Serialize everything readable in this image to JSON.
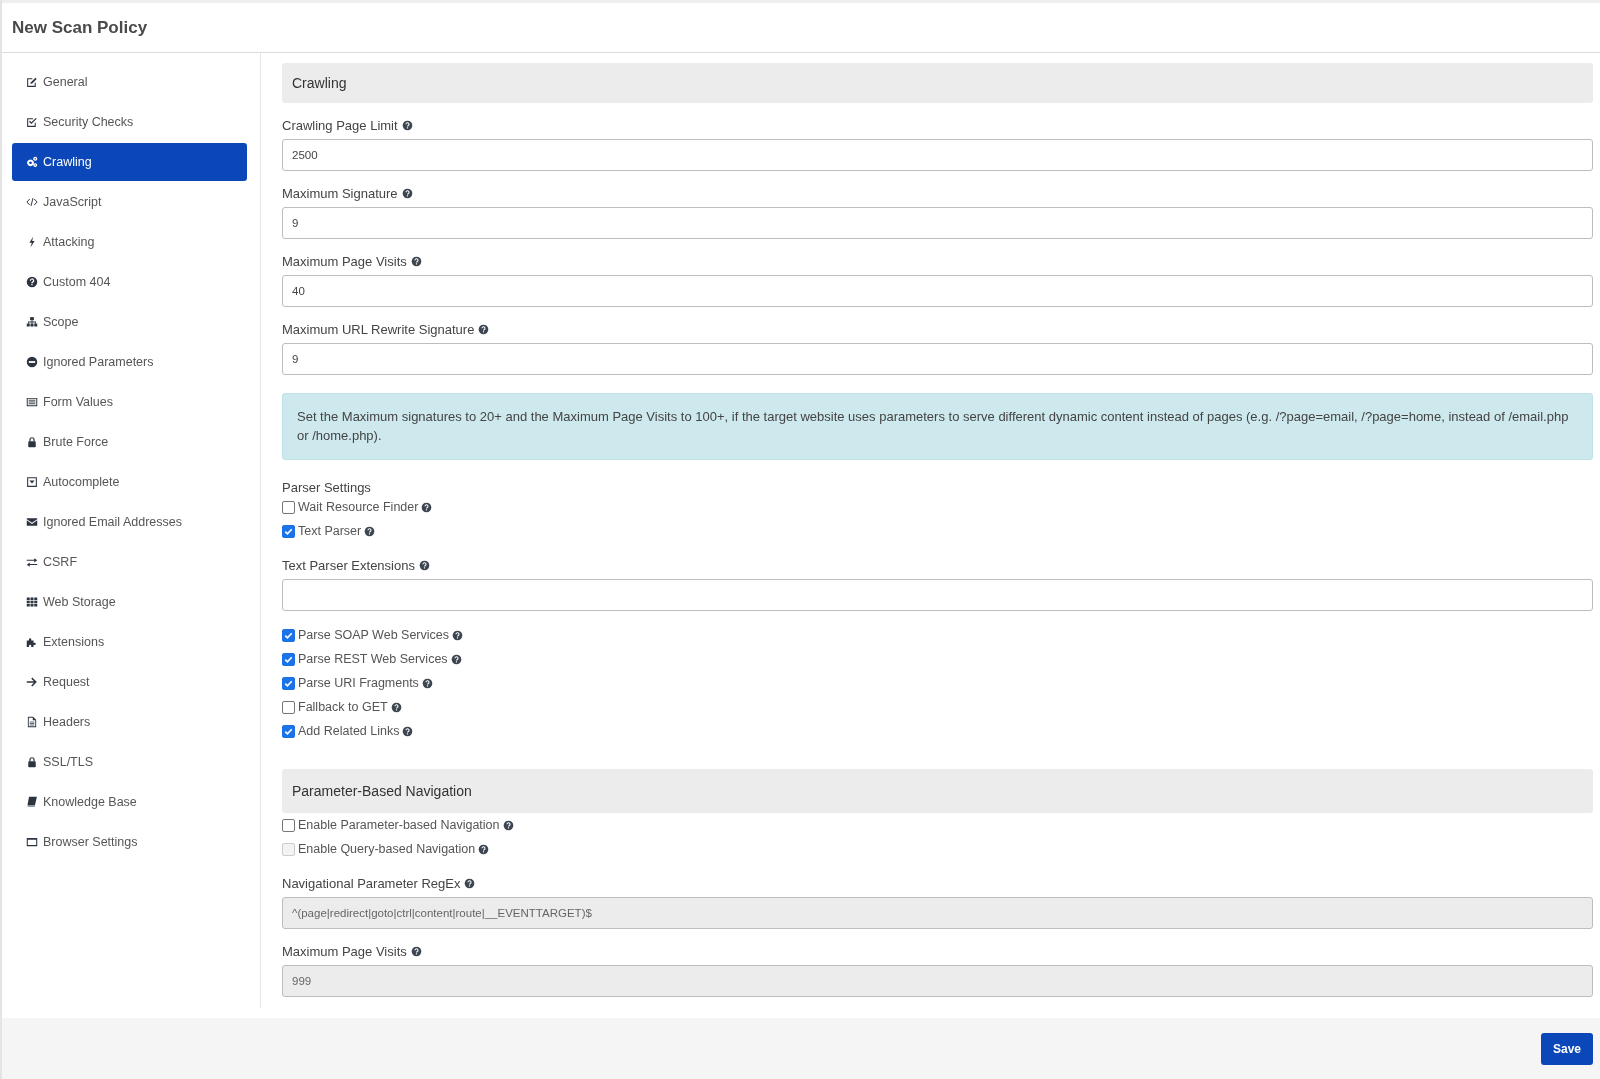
{
  "page": {
    "title": "New Scan Policy"
  },
  "sidebar": {
    "items": [
      {
        "label": "General",
        "selected": false
      },
      {
        "label": "Security Checks",
        "selected": false
      },
      {
        "label": "Crawling",
        "selected": true
      },
      {
        "label": "JavaScript",
        "selected": false
      },
      {
        "label": "Attacking",
        "selected": false
      },
      {
        "label": "Custom 404",
        "selected": false
      },
      {
        "label": "Scope",
        "selected": false
      },
      {
        "label": "Ignored Parameters",
        "selected": false
      },
      {
        "label": "Form Values",
        "selected": false
      },
      {
        "label": "Brute Force",
        "selected": false
      },
      {
        "label": "Autocomplete",
        "selected": false
      },
      {
        "label": "Ignored Email Addresses",
        "selected": false
      },
      {
        "label": "CSRF",
        "selected": false
      },
      {
        "label": "Web Storage",
        "selected": false
      },
      {
        "label": "Extensions",
        "selected": false
      },
      {
        "label": "Request",
        "selected": false
      },
      {
        "label": "Headers",
        "selected": false
      },
      {
        "label": "SSL/TLS",
        "selected": false
      },
      {
        "label": "Knowledge Base",
        "selected": false
      },
      {
        "label": "Browser Settings",
        "selected": false
      }
    ]
  },
  "main": {
    "sections": [
      {
        "title": "Crawling",
        "items": [
          {
            "kind": "field",
            "label": "Crawling Page Limit",
            "value": "2500",
            "disabled": false
          },
          {
            "kind": "field",
            "label": "Maximum Signature",
            "value": "9",
            "disabled": false
          },
          {
            "kind": "field",
            "label": "Maximum Page Visits",
            "value": "40",
            "disabled": false
          },
          {
            "kind": "field",
            "label": "Maximum URL Rewrite Signature",
            "value": "9",
            "disabled": false
          },
          {
            "kind": "note",
            "text": "Set the Maximum signatures to 20+ and the Maximum Page Visits to 100+, if the target website uses parameters to serve different dynamic content instead of pages (e.g. /?page=email, /?page=home, instead of /email.php or /home.php)."
          },
          {
            "kind": "heading",
            "label": "Parser Settings"
          },
          {
            "kind": "checkbox",
            "label": "Wait Resource Finder",
            "checked": false,
            "disabled": false
          },
          {
            "kind": "checkbox",
            "label": "Text Parser",
            "checked": true,
            "disabled": false
          },
          {
            "kind": "field",
            "label": "Text Parser Extensions",
            "disabled": false
          },
          {
            "kind": "checkbox",
            "label": "Parse SOAP Web Services",
            "checked": true,
            "disabled": false
          },
          {
            "kind": "checkbox",
            "label": "Parse REST Web Services",
            "checked": true,
            "disabled": false
          },
          {
            "kind": "checkbox",
            "label": "Parse URI Fragments",
            "checked": true,
            "disabled": false
          },
          {
            "kind": "checkbox",
            "label": "Fallback to GET",
            "checked": false,
            "disabled": false
          },
          {
            "kind": "checkbox",
            "label": "Add Related Links",
            "checked": true,
            "disabled": false
          }
        ]
      },
      {
        "title": "Parameter-Based Navigation",
        "items": [
          {
            "kind": "checkbox",
            "label": "Enable Parameter-based Navigation",
            "checked": false,
            "disabled": false
          },
          {
            "kind": "checkbox",
            "label": "Enable Query-based Navigation",
            "checked": false,
            "disabled": true
          },
          {
            "kind": "field",
            "label": "Navigational Parameter RegEx",
            "value": "^(page|redirect|goto|ctrl|content|route|__EVENTTARGET)$",
            "disabled": true
          },
          {
            "kind": "field",
            "label": "Maximum Page Visits",
            "value": "999",
            "disabled": true
          }
        ]
      }
    ]
  },
  "footer": {
    "save_button": "Save"
  }
}
